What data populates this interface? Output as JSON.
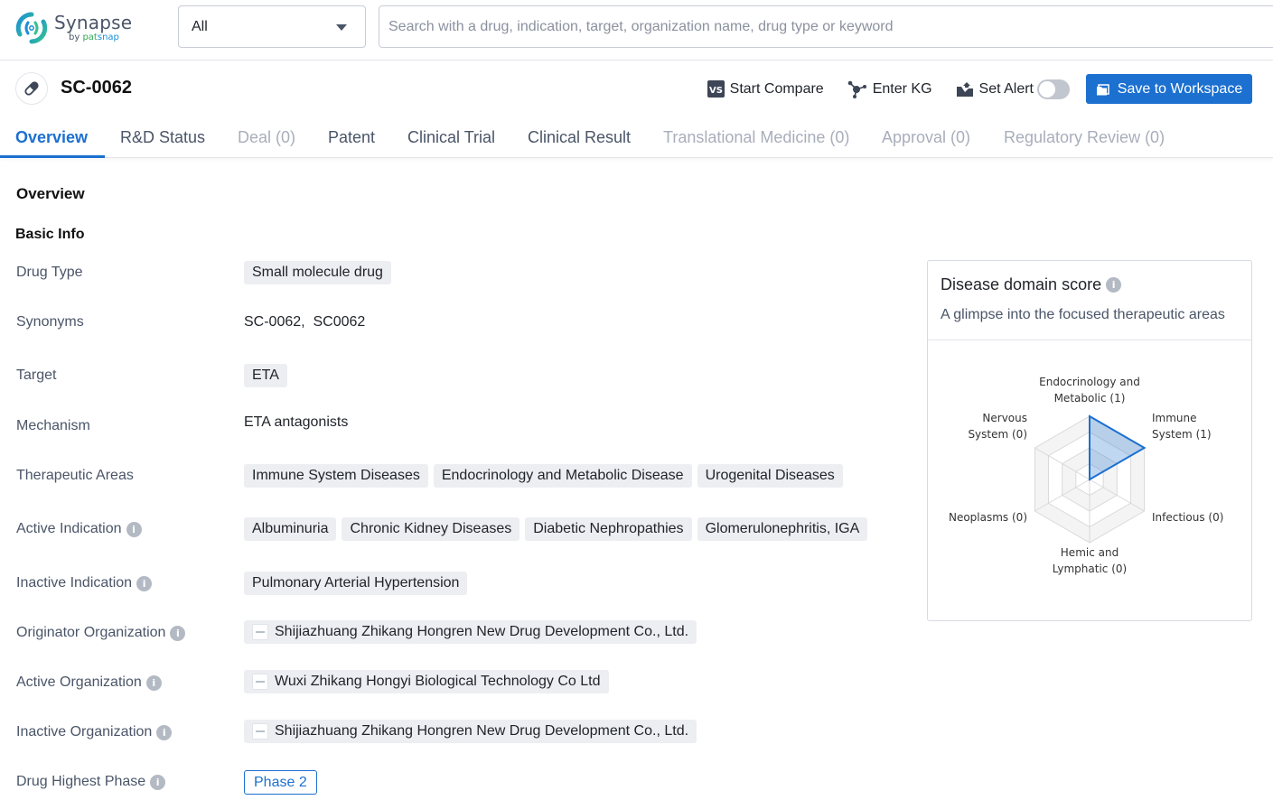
{
  "app": {
    "logo_name": "Synapse",
    "logo_by": "by",
    "logo_pat": "pat",
    "logo_snap": "snap"
  },
  "search": {
    "scope_value": "All",
    "placeholder": "Search with a drug, indication, target, organization name, drug type or keyword",
    "value": ""
  },
  "drug": {
    "title": "SC-0062",
    "icon": "pill-icon"
  },
  "actions": {
    "compare_label": "Start Compare",
    "kg_label": "Enter KG",
    "alert_label": "Set Alert",
    "alert_on": false,
    "save_label": "Save to Workspace"
  },
  "tabs": [
    {
      "label": "Overview",
      "state": "active"
    },
    {
      "label": "R&D Status",
      "state": "normal"
    },
    {
      "label": "Deal (0)",
      "state": "disabled"
    },
    {
      "label": "Patent",
      "state": "normal"
    },
    {
      "label": "Clinical Trial",
      "state": "normal"
    },
    {
      "label": "Clinical Result",
      "state": "normal"
    },
    {
      "label": "Translational Medicine (0)",
      "state": "disabled"
    },
    {
      "label": "Approval (0)",
      "state": "disabled"
    },
    {
      "label": "Regulatory Review (0)",
      "state": "disabled"
    }
  ],
  "overview": {
    "section_title": "Overview",
    "basic_info_title": "Basic Info",
    "rows": {
      "drug_type": {
        "label": "Drug Type",
        "tags": [
          "Small molecule drug"
        ]
      },
      "synonyms": {
        "label": "Synonyms",
        "value": "SC-0062,  SC0062"
      },
      "target": {
        "label": "Target",
        "tags": [
          "ETA"
        ]
      },
      "mechanism": {
        "label": "Mechanism",
        "value": "ETA antagonists"
      },
      "therapeutic_areas": {
        "label": "Therapeutic Areas",
        "tags": [
          "Immune System Diseases",
          "Endocrinology and Metabolic Disease",
          "Urogenital Diseases"
        ]
      },
      "active_indication": {
        "label": "Active Indication",
        "tags": [
          "Albuminuria",
          "Chronic Kidney Diseases",
          "Diabetic Nephropathies",
          "Glomerulonephritis, IGA"
        ]
      },
      "inactive_indication": {
        "label": "Inactive Indication",
        "tags": [
          "Pulmonary Arterial Hypertension"
        ]
      },
      "originator_org": {
        "label": "Originator Organization",
        "orgs": [
          "Shijiazhuang Zhikang Hongren New Drug Development Co., Ltd."
        ]
      },
      "active_org": {
        "label": "Active Organization",
        "orgs": [
          "Wuxi Zhikang Hongyi Biological Technology Co Ltd"
        ]
      },
      "inactive_org": {
        "label": "Inactive Organization",
        "orgs": [
          "Shijiazhuang Zhikang Hongren New Drug Development Co., Ltd."
        ]
      },
      "highest_phase": {
        "label": "Drug Highest Phase",
        "value": "Phase 2"
      }
    }
  },
  "disease_card": {
    "title": "Disease domain score",
    "subtitle": "A glimpse into the focused therapeutic areas",
    "accent": "#1c70d0"
  },
  "chart_data": {
    "type": "radar",
    "title": "Disease domain score",
    "axes": [
      {
        "name": "Endocrinology and Metabolic",
        "lines": [
          "Endocrinology and",
          "Metabolic (1)"
        ],
        "value": 1
      },
      {
        "name": "Immune System",
        "lines": [
          "Immune",
          "System (1)"
        ],
        "value": 1
      },
      {
        "name": "Infectious",
        "lines": [
          "Infectious (0)"
        ],
        "value": 0
      },
      {
        "name": "Hemic and Lymphatic",
        "lines": [
          "Hemic and",
          "Lymphatic (0)"
        ],
        "value": 0
      },
      {
        "name": "Neoplasms",
        "lines": [
          "Neoplasms (0)"
        ],
        "value": 0
      },
      {
        "name": "Nervous System",
        "lines": [
          "Nervous",
          "System (0)"
        ],
        "value": 0
      }
    ],
    "max": 1,
    "rings": 4
  }
}
